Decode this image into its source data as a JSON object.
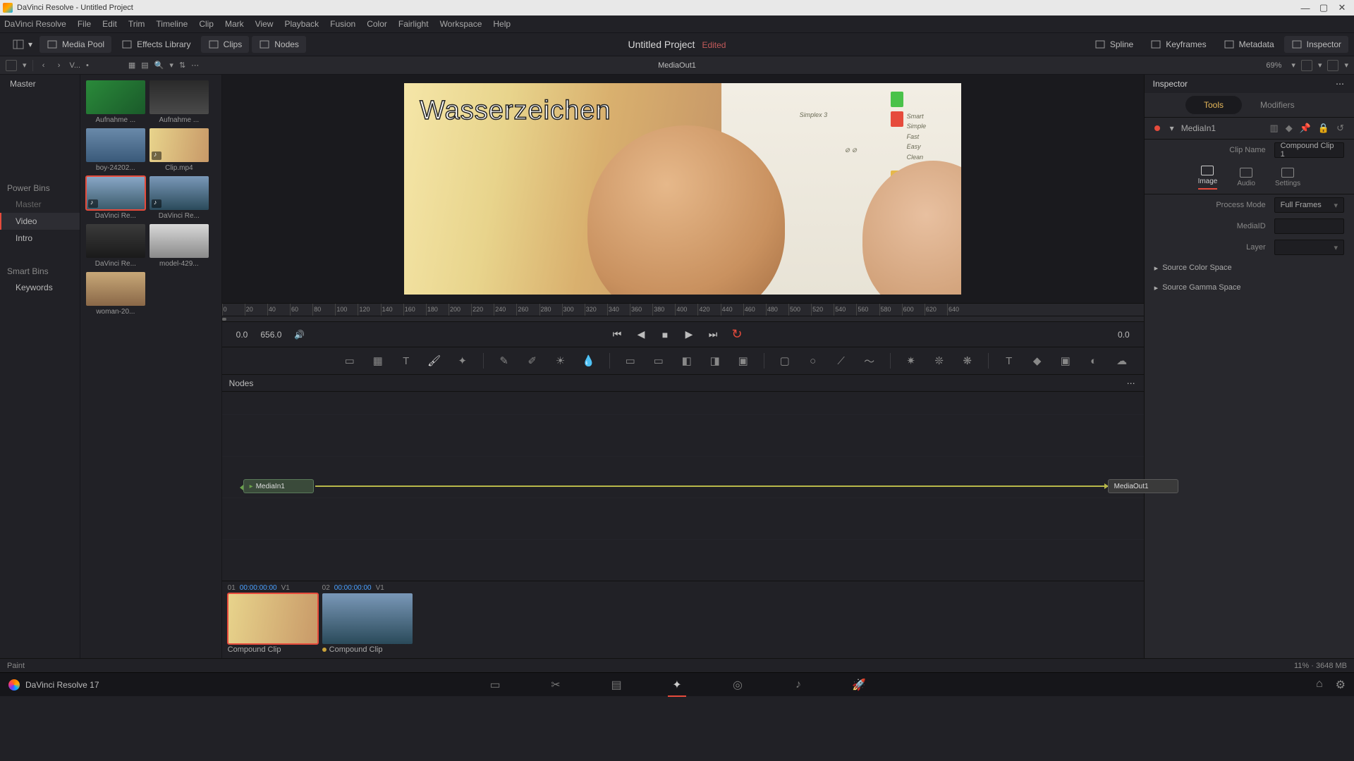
{
  "window": {
    "title": "DaVinci Resolve - Untitled Project"
  },
  "menu": [
    "DaVinci Resolve",
    "File",
    "Edit",
    "Trim",
    "Timeline",
    "Clip",
    "Mark",
    "View",
    "Playback",
    "Fusion",
    "Color",
    "Fairlight",
    "Workspace",
    "Help"
  ],
  "shelf": {
    "left": [
      {
        "icon": "media-pool-icon",
        "label": "Media Pool",
        "active": true
      },
      {
        "icon": "effects-icon",
        "label": "Effects Library",
        "active": false
      },
      {
        "icon": "clips-icon",
        "label": "Clips",
        "active": true
      },
      {
        "icon": "nodes-icon",
        "label": "Nodes",
        "active": true
      }
    ],
    "title": "Untitled Project",
    "edited": "Edited",
    "right": [
      {
        "icon": "spline-icon",
        "label": "Spline"
      },
      {
        "icon": "keyframes-icon",
        "label": "Keyframes"
      },
      {
        "icon": "metadata-icon",
        "label": "Metadata"
      },
      {
        "icon": "inspector-icon",
        "label": "Inspector",
        "active": true
      }
    ]
  },
  "subbar": {
    "bin": "V...",
    "zoom": "69%",
    "viewer_title": "MediaOut1",
    "inspector_title": "Inspector"
  },
  "bins": {
    "master": "Master",
    "power": "Power Bins",
    "power_items": [
      {
        "label": "Master",
        "dim": true
      },
      {
        "label": "Video",
        "sel": true
      },
      {
        "label": "Intro"
      }
    ],
    "smart": "Smart Bins",
    "smart_items": [
      "Keywords"
    ]
  },
  "pool": [
    {
      "label": "Aufnahme ...",
      "bg": "linear-gradient(135deg,#2a8a3a,#1a5a2a)"
    },
    {
      "label": "Aufnahme ...",
      "bg": "linear-gradient(#2a2a2a,#4a4a4a)"
    },
    {
      "label": "boy-24202...",
      "bg": "linear-gradient(#6a8aaa,#3a5a7a)"
    },
    {
      "label": "Clip.mp4",
      "bg": "linear-gradient(100deg,#e8d48c,#c89968)",
      "audio": true
    },
    {
      "label": "DaVinci Re...",
      "bg": "linear-gradient(#8aa8c8,#3a5a6a)",
      "audio": true,
      "sel": true
    },
    {
      "label": "DaVinci Re...",
      "bg": "linear-gradient(#7a98b8,#2a4a5a)",
      "audio": true
    },
    {
      "label": "DaVinci Re...",
      "bg": "linear-gradient(#3a3a3a,#1a1a1a)"
    },
    {
      "label": "model-429...",
      "bg": "linear-gradient(#d8d8d8,#8a8a8a)"
    },
    {
      "label": "woman-20...",
      "bg": "linear-gradient(#c8a878,#8a6848)"
    }
  ],
  "canvas": {
    "watermark": "Wasserzeichen"
  },
  "ruler_ticks": [
    0,
    20,
    40,
    60,
    80,
    100,
    120,
    140,
    160,
    180,
    200,
    220,
    240,
    260,
    280,
    300,
    320,
    340,
    360,
    380,
    400,
    420,
    440,
    460,
    480,
    500,
    520,
    540,
    560,
    580,
    600,
    620,
    640
  ],
  "transport": {
    "start": "0.0",
    "end": "656.0",
    "pos": "0.0"
  },
  "nodes": {
    "title": "Nodes",
    "in": "MediaIn1",
    "out": "MediaOut1"
  },
  "clips": [
    {
      "idx": "01",
      "tc": "00:00:00:00",
      "trk": "V1",
      "label": "Compound Clip",
      "sel": true,
      "bg": "linear-gradient(100deg,#e8d48c,#c89968)"
    },
    {
      "idx": "02",
      "tc": "00:00:00:00",
      "trk": "V1",
      "label": "Compound Clip",
      "sel": false,
      "dot": true,
      "bg": "linear-gradient(#7a98b8,#2a4a5a)"
    }
  ],
  "inspector": {
    "tabs": [
      {
        "label": "Tools",
        "act": true
      },
      {
        "label": "Modifiers"
      }
    ],
    "node": "MediaIn1",
    "clipname_label": "Clip Name",
    "clipname": "Compound Clip 1",
    "subtabs": [
      {
        "label": "Image",
        "act": true
      },
      {
        "label": "Audio"
      },
      {
        "label": "Settings"
      }
    ],
    "rows": [
      {
        "label": "Process Mode",
        "value": "Full Frames",
        "dd": true
      },
      {
        "label": "MediaID",
        "value": ""
      },
      {
        "label": "Layer",
        "value": "",
        "dd": true
      }
    ],
    "collapse": [
      "Source Color Space",
      "Source Gamma Space"
    ]
  },
  "hint": {
    "left": "Paint",
    "right": "11% · 3648 MB"
  },
  "pagebar": {
    "app": "DaVinci Resolve 17"
  }
}
